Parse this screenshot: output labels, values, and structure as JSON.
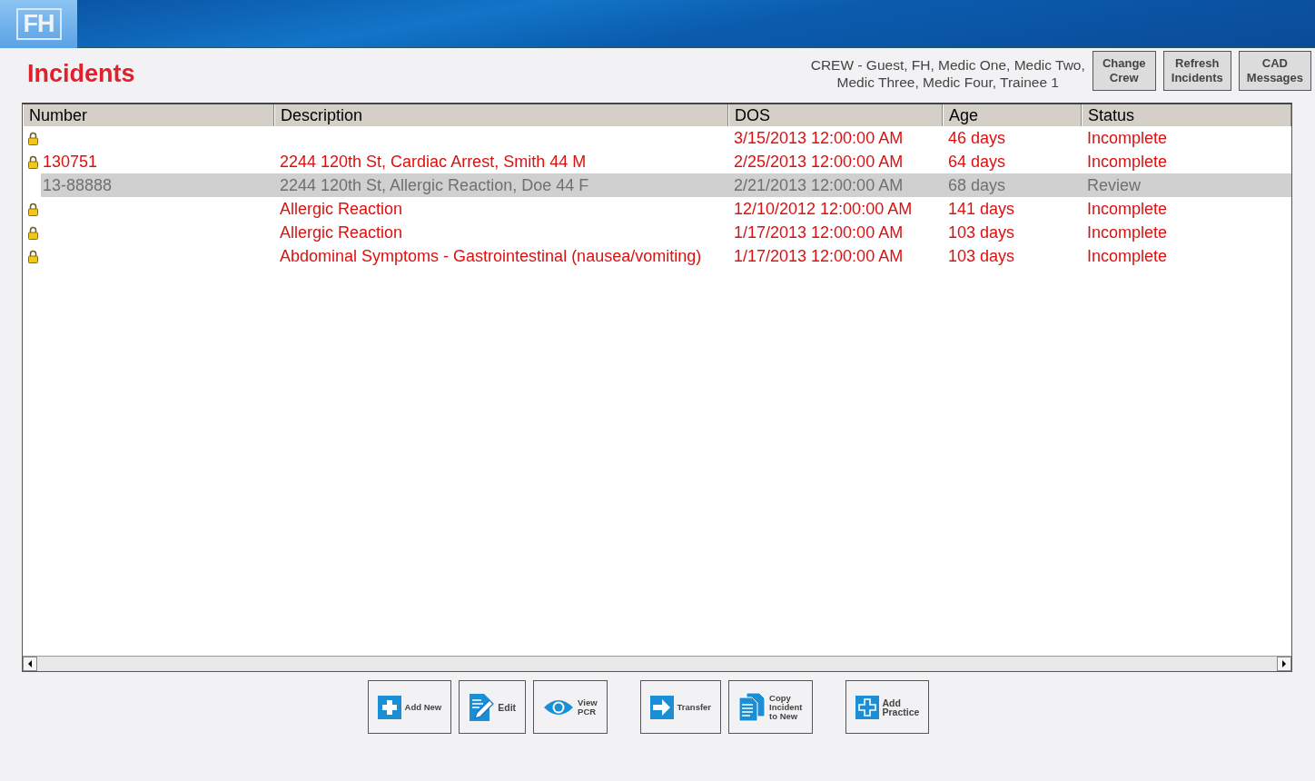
{
  "app": {
    "logo": "FH"
  },
  "page": {
    "title": "Incidents"
  },
  "crew": {
    "lines": [
      "CREW - Guest, FH, Medic One, Medic Two,",
      "Medic Three,  Medic Four, Trainee 1"
    ]
  },
  "top_buttons": [
    {
      "label": [
        "Change",
        "Crew"
      ]
    },
    {
      "label": [
        "Refresh",
        "Incidents"
      ]
    },
    {
      "label": [
        "CAD",
        "Messages"
      ]
    }
  ],
  "table": {
    "columns": [
      "Number",
      "Description",
      "DOS",
      "Age",
      "Status"
    ],
    "rows": [
      {
        "locked": true,
        "selected": false,
        "cells": [
          "",
          "",
          "3/15/2013 12:00:00 AM",
          "46 days",
          "Incomplete"
        ]
      },
      {
        "locked": true,
        "selected": false,
        "cells": [
          "130751",
          "2244 120th St, Cardiac Arrest, Smith 44 M",
          "2/25/2013 12:00:00 AM",
          "64 days",
          "Incomplete"
        ]
      },
      {
        "locked": false,
        "selected": true,
        "cells": [
          "13-88888",
          "2244 120th St, Allergic Reaction, Doe 44 F",
          "2/21/2013 12:00:00 AM",
          "68 days",
          "Review"
        ]
      },
      {
        "locked": true,
        "selected": false,
        "cells": [
          "",
          "Allergic Reaction",
          "12/10/2012 12:00:00 AM",
          "141 days",
          "Incomplete"
        ]
      },
      {
        "locked": true,
        "selected": false,
        "cells": [
          "",
          "Allergic Reaction",
          "1/17/2013 12:00:00 AM",
          "103 days",
          "Incomplete"
        ]
      },
      {
        "locked": true,
        "selected": false,
        "cells": [
          "",
          "Abdominal Symptoms - Gastrointestinal (nausea/vomiting)",
          "1/17/2013 12:00:00 AM",
          "103 days",
          "Incomplete"
        ]
      }
    ]
  },
  "action_groups": [
    [
      {
        "kind": "add",
        "label": [
          "Add New"
        ]
      },
      {
        "kind": "edit",
        "label": [
          "Edit"
        ]
      },
      {
        "kind": "view",
        "label": [
          "View",
          "PCR"
        ]
      }
    ],
    [
      {
        "kind": "transfer",
        "label": [
          "Transfer"
        ]
      },
      {
        "kind": "copy",
        "label": [
          "Copy",
          "Incident",
          "to New"
        ]
      }
    ],
    [
      {
        "kind": "practice",
        "label": [
          "Add",
          "Practice"
        ]
      }
    ]
  ]
}
